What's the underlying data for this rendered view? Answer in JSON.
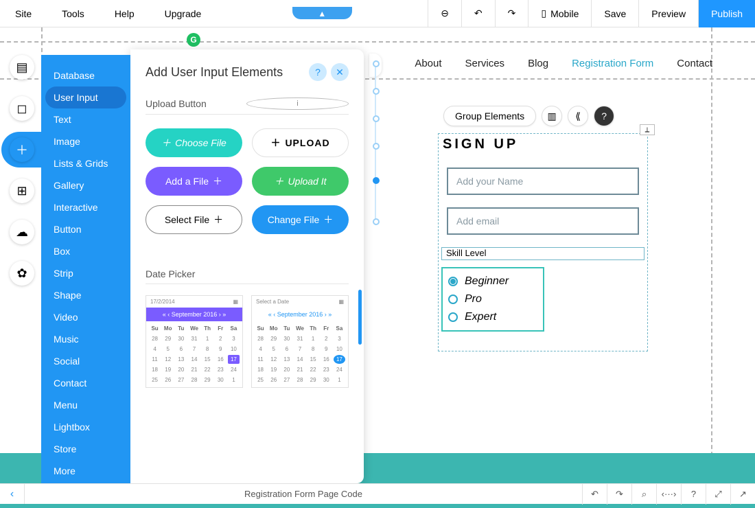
{
  "toolbar": {
    "menus": [
      "Site",
      "Tools",
      "Help",
      "Upgrade"
    ],
    "mobile": "Mobile",
    "save": "Save",
    "preview": "Preview",
    "publish": "Publish"
  },
  "categories": [
    "Database",
    "User Input",
    "Text",
    "Image",
    "Lists & Grids",
    "Gallery",
    "Interactive",
    "Button",
    "Box",
    "Strip",
    "Shape",
    "Video",
    "Music",
    "Social",
    "Contact",
    "Menu",
    "Lightbox",
    "Store",
    "More"
  ],
  "activeCategory": "User Input",
  "panel": {
    "title": "Add User Input Elements",
    "upload_section": "Upload Button",
    "date_section": "Date Picker",
    "buttons": {
      "choose": "Choose File",
      "upload": "UPLOAD",
      "addfile": "Add a File",
      "uploadit": "Upload It",
      "selectfile": "Select File",
      "changefile": "Change File"
    },
    "cal1": {
      "date_display": "17/2/2014",
      "month": "September 2016",
      "selected": 17
    },
    "cal2": {
      "placeholder": "Select a Date",
      "month": "September 2016",
      "selected": 17
    },
    "weekdays": [
      "Su",
      "Mo",
      "Tu",
      "We",
      "Th",
      "Fr",
      "Sa"
    ]
  },
  "siteNav": [
    "About",
    "Services",
    "Blog",
    "Registration Form",
    "Contact"
  ],
  "activeNav": "Registration Form",
  "formToolbar": {
    "group": "Group Elements"
  },
  "form": {
    "title": "SIGN UP",
    "name_ph": "Add your Name",
    "email_ph": "Add email",
    "skill_label": "Skill Level",
    "options": [
      "Beginner",
      "Pro",
      "Expert"
    ]
  },
  "bottombar": {
    "title": "Registration Form Page Code"
  }
}
